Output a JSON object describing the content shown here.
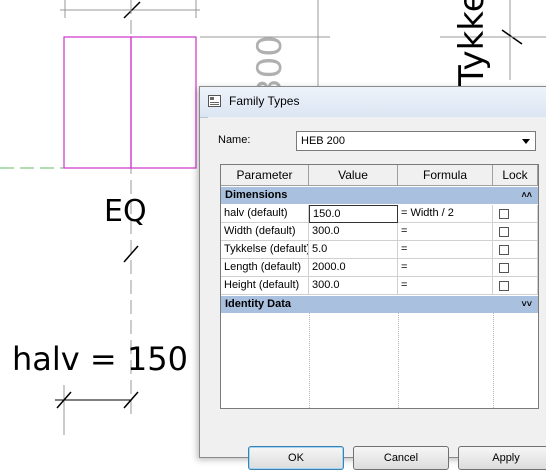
{
  "drawing": {
    "dim_vertical_text": "300",
    "dim_vertical_text_right": "Tykkelse",
    "eq_label": "EQ",
    "halv_label": "halv = 150",
    "colors": {
      "magenta": "#cc33cc",
      "dash_green": "#66bb66",
      "line_gray": "#999999"
    }
  },
  "dialog": {
    "title": "Family Types",
    "name_label": "Name:",
    "name_value": "HEB 200",
    "columns": [
      "Parameter",
      "Value",
      "Formula",
      "Lock"
    ],
    "groups": [
      {
        "label": "Dimensions",
        "chevron": "collapse-icon",
        "rows": [
          {
            "parameter": "halv (default)",
            "value": "150.0",
            "formula": "= Width / 2",
            "locked": false,
            "active": true
          },
          {
            "parameter": "Width (default)",
            "value": "300.0",
            "formula": "=",
            "locked": false,
            "active": false
          },
          {
            "parameter": "Tykkelse (default)",
            "value": "5.0",
            "formula": "=",
            "locked": false,
            "active": false
          },
          {
            "parameter": "Length (default)",
            "value": "2000.0",
            "formula": "=",
            "locked": false,
            "active": false
          },
          {
            "parameter": "Height (default)",
            "value": "300.0",
            "formula": "=",
            "locked": false,
            "active": false
          }
        ]
      },
      {
        "label": "Identity Data",
        "chevron": "expand-icon",
        "rows": []
      }
    ],
    "buttons": {
      "ok": "OK",
      "cancel": "Cancel",
      "apply": "Apply"
    }
  }
}
